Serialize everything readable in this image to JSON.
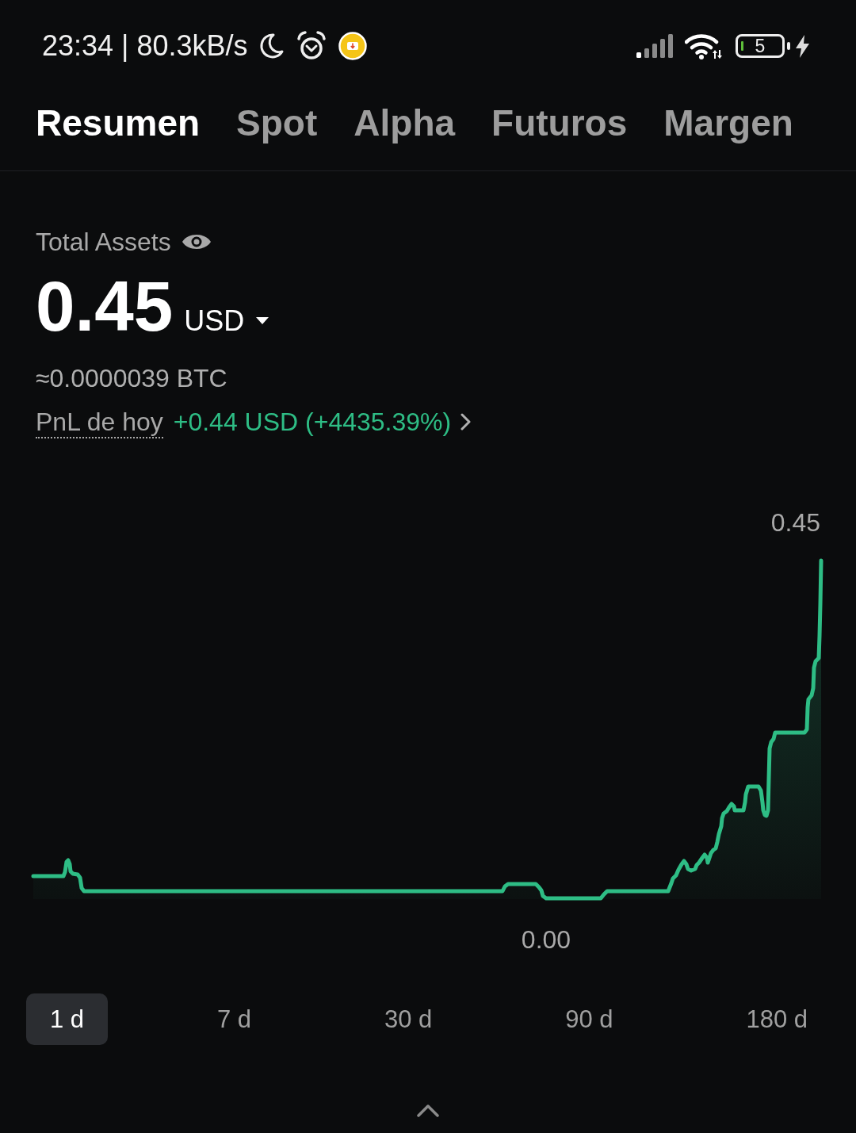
{
  "status_bar": {
    "text": "23:34 | 80.3kB/s",
    "battery_text": "5"
  },
  "tabs": [
    {
      "label": "Resumen",
      "selected": true
    },
    {
      "label": "Spot",
      "selected": false
    },
    {
      "label": "Alpha",
      "selected": false
    },
    {
      "label": "Futuros",
      "selected": false
    },
    {
      "label": "Margen",
      "selected": false
    }
  ],
  "total_assets": {
    "label": "Total Assets",
    "amount": "0.45",
    "currency": "USD",
    "btc_equivalent": "≈0.0000039 BTC"
  },
  "pnl": {
    "label": "PnL de hoy",
    "value": "+0.44 USD (+4435.39%)"
  },
  "chart": {
    "max_label": "0.45",
    "min_label": "0.00"
  },
  "ranges": [
    {
      "label": "1 d",
      "selected": true
    },
    {
      "label": "7 d",
      "selected": false
    },
    {
      "label": "30 d",
      "selected": false
    },
    {
      "label": "90 d",
      "selected": false
    },
    {
      "label": "180 d",
      "selected": false
    }
  ]
}
